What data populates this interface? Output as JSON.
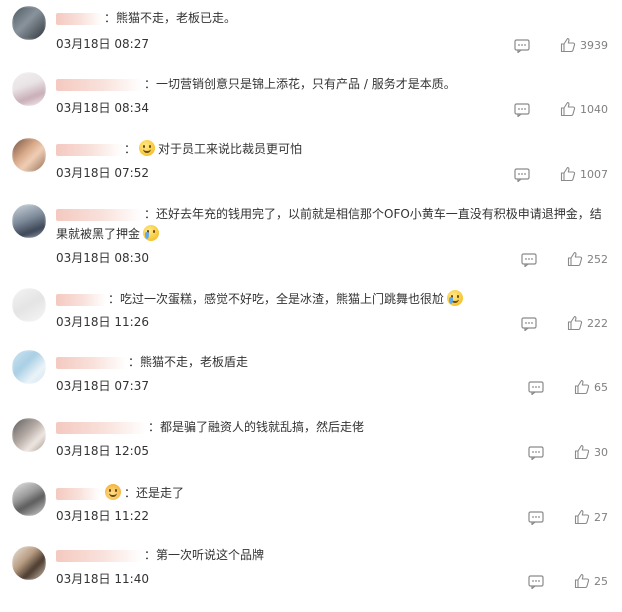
{
  "colors": {
    "text": "#333333",
    "muted": "#808080",
    "icon": "#8a8a8a",
    "name_blur": "#f4c9c0"
  },
  "icons": {
    "reply": "comment-icon",
    "like": "thumbs-up-icon"
  },
  "comments": [
    {
      "separator": "：",
      "text": "熊猫不走，老板已走。",
      "date": "03月18日",
      "time": "08:27",
      "likes": "3939"
    },
    {
      "separator": "：",
      "text": "一切营销创意只是锦上添花，只有产品 / 服务才是本质。",
      "date": "03月18日",
      "time": "08:34",
      "likes": "1040"
    },
    {
      "separator": "：",
      "text": "对于员工来说比裁员更可怕",
      "date": "03月18日",
      "time": "07:52",
      "likes": "1007"
    },
    {
      "separator": "：",
      "text": "还好去年充的钱用完了，以前就是相信那个OFO小黄车一直没有积极申请退押金，结果就被黑了押金",
      "date": "03月18日",
      "time": "08:30",
      "likes": "252"
    },
    {
      "separator": "：",
      "text": "吃过一次蛋糕，感觉不好吃，全是冰渣，熊猫上门跳舞也很尬",
      "date": "03月18日",
      "time": "11:26",
      "likes": "222"
    },
    {
      "separator": "：",
      "text": "熊猫不走，老板盾走",
      "date": "03月18日",
      "time": "07:37",
      "likes": "65"
    },
    {
      "separator": "：",
      "text": "都是骗了融资人的钱就乱搞，然后走佬",
      "date": "03月18日",
      "time": "12:05",
      "likes": "30"
    },
    {
      "separator": "：",
      "text": "还是走了",
      "date": "03月18日",
      "time": "11:22",
      "likes": "27"
    },
    {
      "separator": "：",
      "text": "第一次听说这个品牌",
      "date": "03月18日",
      "time": "11:40",
      "likes": "25"
    }
  ]
}
